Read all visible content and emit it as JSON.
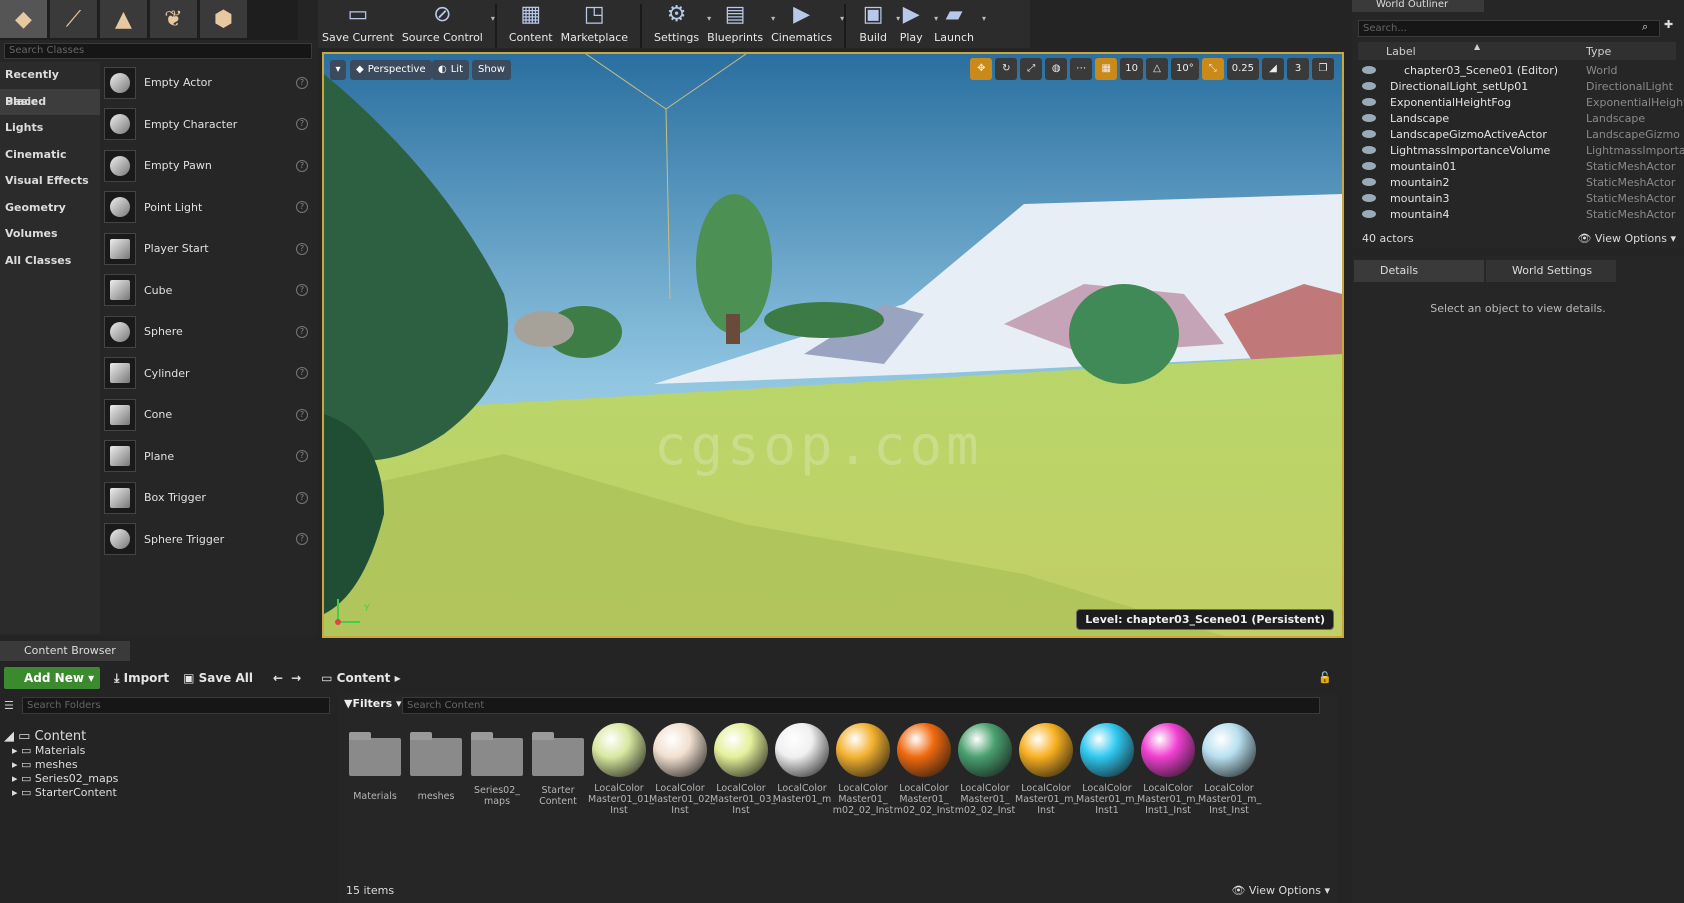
{
  "modes": [
    "place-mode-icon",
    "paint-mode-icon",
    "landscape-mode-icon",
    "foliage-mode-icon",
    "geometry-mode-icon"
  ],
  "toolbar": [
    {
      "label": "Save Current",
      "icon": "save-icon",
      "dd": false
    },
    {
      "label": "Source Control",
      "icon": "source-control-icon",
      "dd": true
    },
    {
      "label": "Content",
      "icon": "content-icon",
      "dd": false
    },
    {
      "label": "Marketplace",
      "icon": "marketplace-icon",
      "dd": false
    },
    {
      "label": "Settings",
      "icon": "settings-icon",
      "dd": true
    },
    {
      "label": "Blueprints",
      "icon": "blueprints-icon",
      "dd": true
    },
    {
      "label": "Cinematics",
      "icon": "cinematics-icon",
      "dd": true
    },
    {
      "label": "Build",
      "icon": "build-icon",
      "dd": true
    },
    {
      "label": "Play",
      "icon": "play-icon",
      "dd": true
    },
    {
      "label": "Launch",
      "icon": "launch-icon",
      "dd": true
    }
  ],
  "place": {
    "search_placeholder": "Search Classes",
    "categories": [
      "Recently Placed",
      "Basic",
      "Lights",
      "Cinematic",
      "Visual Effects",
      "Geometry",
      "Volumes",
      "All Classes"
    ],
    "active_category": "Basic",
    "items": [
      "Empty Actor",
      "Empty Character",
      "Empty Pawn",
      "Point Light",
      "Player Start",
      "Cube",
      "Sphere",
      "Cylinder",
      "Cone",
      "Plane",
      "Box Trigger",
      "Sphere Trigger"
    ]
  },
  "viewport": {
    "perspective": "Perspective",
    "lit": "Lit",
    "show": "Show",
    "grid_snap": "10",
    "rot_snap": "10°",
    "scale_snap": "0.25",
    "cam_speed": "3",
    "level": "Level:  chapter03_Scene01 (Persistent)",
    "watermark": "cgsop.com",
    "axis_y": "Y"
  },
  "outliner": {
    "tab": "World Outliner",
    "search_placeholder": "Search...",
    "col_label": "Label",
    "col_type": "Type",
    "rows": [
      {
        "label": "chapter03_Scene01 (Editor)",
        "type": "World"
      },
      {
        "label": "DirectionalLight_setUp01",
        "type": "DirectionalLight"
      },
      {
        "label": "ExponentialHeightFog",
        "type": "ExponentialHeight"
      },
      {
        "label": "Landscape",
        "type": "Landscape"
      },
      {
        "label": "LandscapeGizmoActiveActor",
        "type": "LandscapeGizmo"
      },
      {
        "label": "LightmassImportanceVolume",
        "type": "LightmassImporta"
      },
      {
        "label": "mountain01",
        "type": "StaticMeshActor"
      },
      {
        "label": "mountain2",
        "type": "StaticMeshActor"
      },
      {
        "label": "mountain3",
        "type": "StaticMeshActor"
      },
      {
        "label": "mountain4",
        "type": "StaticMeshActor"
      }
    ],
    "actors": "40 actors",
    "view_options": "View Options"
  },
  "details": {
    "tab1": "Details",
    "tab2": "World Settings",
    "message": "Select an object to view details."
  },
  "content_browser": {
    "tab": "Content Browser",
    "add_new": "Add New",
    "import": "Import",
    "save_all": "Save All",
    "path": "Content",
    "search_folders": "Search Folders",
    "folders": [
      "Content",
      "Materials",
      "meshes",
      "Series02_maps",
      "StarterContent"
    ],
    "filters": "Filters",
    "search_content": "Search Content",
    "assets": [
      {
        "name": "Materials",
        "kind": "folder"
      },
      {
        "name": "meshes",
        "kind": "folder"
      },
      {
        "name": "Series02_ maps",
        "kind": "folder"
      },
      {
        "name": "Starter Content",
        "kind": "folder"
      },
      {
        "name": "LocalColor Master01_01_ Inst",
        "kind": "mat",
        "color": "#d8e8a0"
      },
      {
        "name": "LocalColor Master01_02_ Inst",
        "kind": "mat",
        "color": "#f2e0d0"
      },
      {
        "name": "LocalColor Master01_03_ Inst",
        "kind": "mat",
        "color": "#e4f09a"
      },
      {
        "name": "LocalColor Master01_m",
        "kind": "mat",
        "color": "#f0f0f0"
      },
      {
        "name": "LocalColor Master01_ m02_02_Inst",
        "kind": "mat",
        "color": "#f4b230"
      },
      {
        "name": "LocalColor Master01_ m02_02_Inst",
        "kind": "mat",
        "color": "#f06a10"
      },
      {
        "name": "LocalColor Master01_ m02_02_Inst",
        "kind": "mat",
        "color": "#4aa070"
      },
      {
        "name": "LocalColor Master01_m_ Inst",
        "kind": "mat",
        "color": "#f8b020"
      },
      {
        "name": "LocalColor Master01_m_ Inst1",
        "kind": "mat",
        "color": "#30c8f0"
      },
      {
        "name": "LocalColor Master01_m_ Inst1_Inst",
        "kind": "mat",
        "color": "#f040d0"
      },
      {
        "name": "LocalColor Master01_m_ Inst_Inst",
        "kind": "mat",
        "color": "#b8e0f0"
      }
    ],
    "count": "15 items",
    "view_options": "View Options"
  }
}
